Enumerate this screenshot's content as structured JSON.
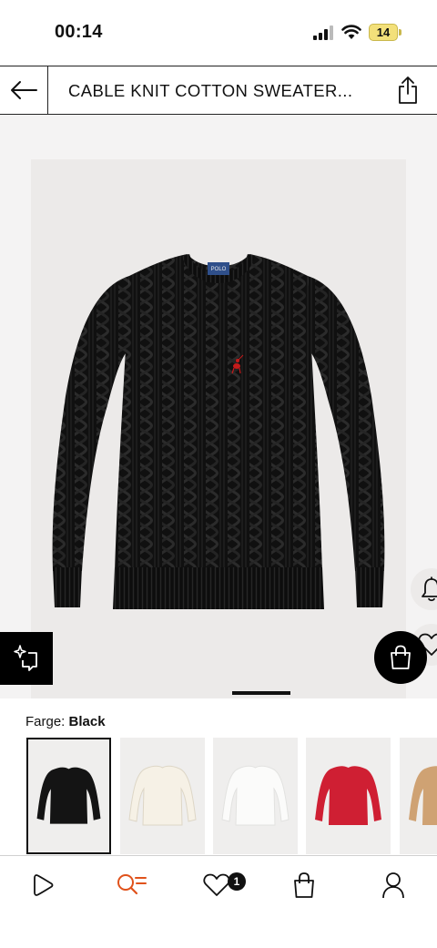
{
  "status_bar": {
    "time": "00:14",
    "battery": "14"
  },
  "header": {
    "title": "CABLE KNIT COTTON SWEATER...",
    "back_icon": "arrow-left-icon",
    "share_icon": "share-icon"
  },
  "product": {
    "tag_text": "POLO",
    "actions": {
      "notify_icon": "bell-icon",
      "wishlist_icon": "heart-icon",
      "add_to_bag_icon": "shopping-bag-icon",
      "visual_search_icon": "sparkle-search-icon"
    }
  },
  "color": {
    "label": "Farge:",
    "selected": "Black",
    "swatches": [
      {
        "name": "Black",
        "hex": "#141414",
        "selected": true
      },
      {
        "name": "Cream",
        "hex": "#f1ece0",
        "selected": false
      },
      {
        "name": "White",
        "hex": "#f7f7f5",
        "selected": false
      },
      {
        "name": "Red",
        "hex": "#cf1f33",
        "selected": false
      },
      {
        "name": "Camel",
        "hex": "#cfa273",
        "selected": false
      }
    ]
  },
  "bottom_nav": {
    "items": [
      {
        "name": "play",
        "icon": "play-icon"
      },
      {
        "name": "search",
        "icon": "search-icon",
        "color": "#e0521b"
      },
      {
        "name": "wishlist",
        "icon": "heart-icon"
      },
      {
        "name": "bag",
        "icon": "shopping-bag-icon"
      },
      {
        "name": "profile",
        "icon": "user-icon"
      }
    ],
    "wishlist_count": "1"
  }
}
